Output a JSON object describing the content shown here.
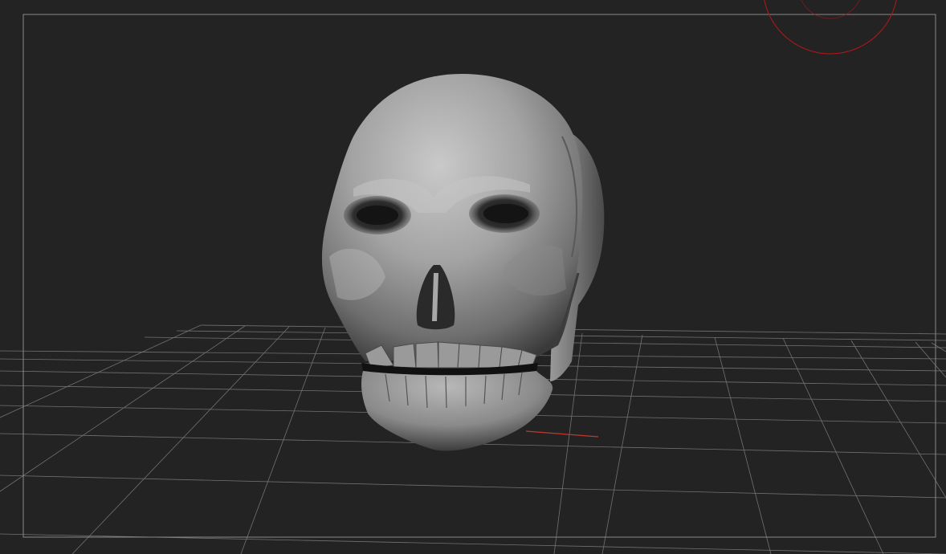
{
  "viewport": {
    "background": "#232323",
    "frame_color": "#8a8a8a",
    "grid_color": "#8c8c8c",
    "axis_color": "#c0392b",
    "brush_color": "#b01818",
    "model": "skull-mesh",
    "icons": [
      "brush-cursor-icon"
    ]
  }
}
